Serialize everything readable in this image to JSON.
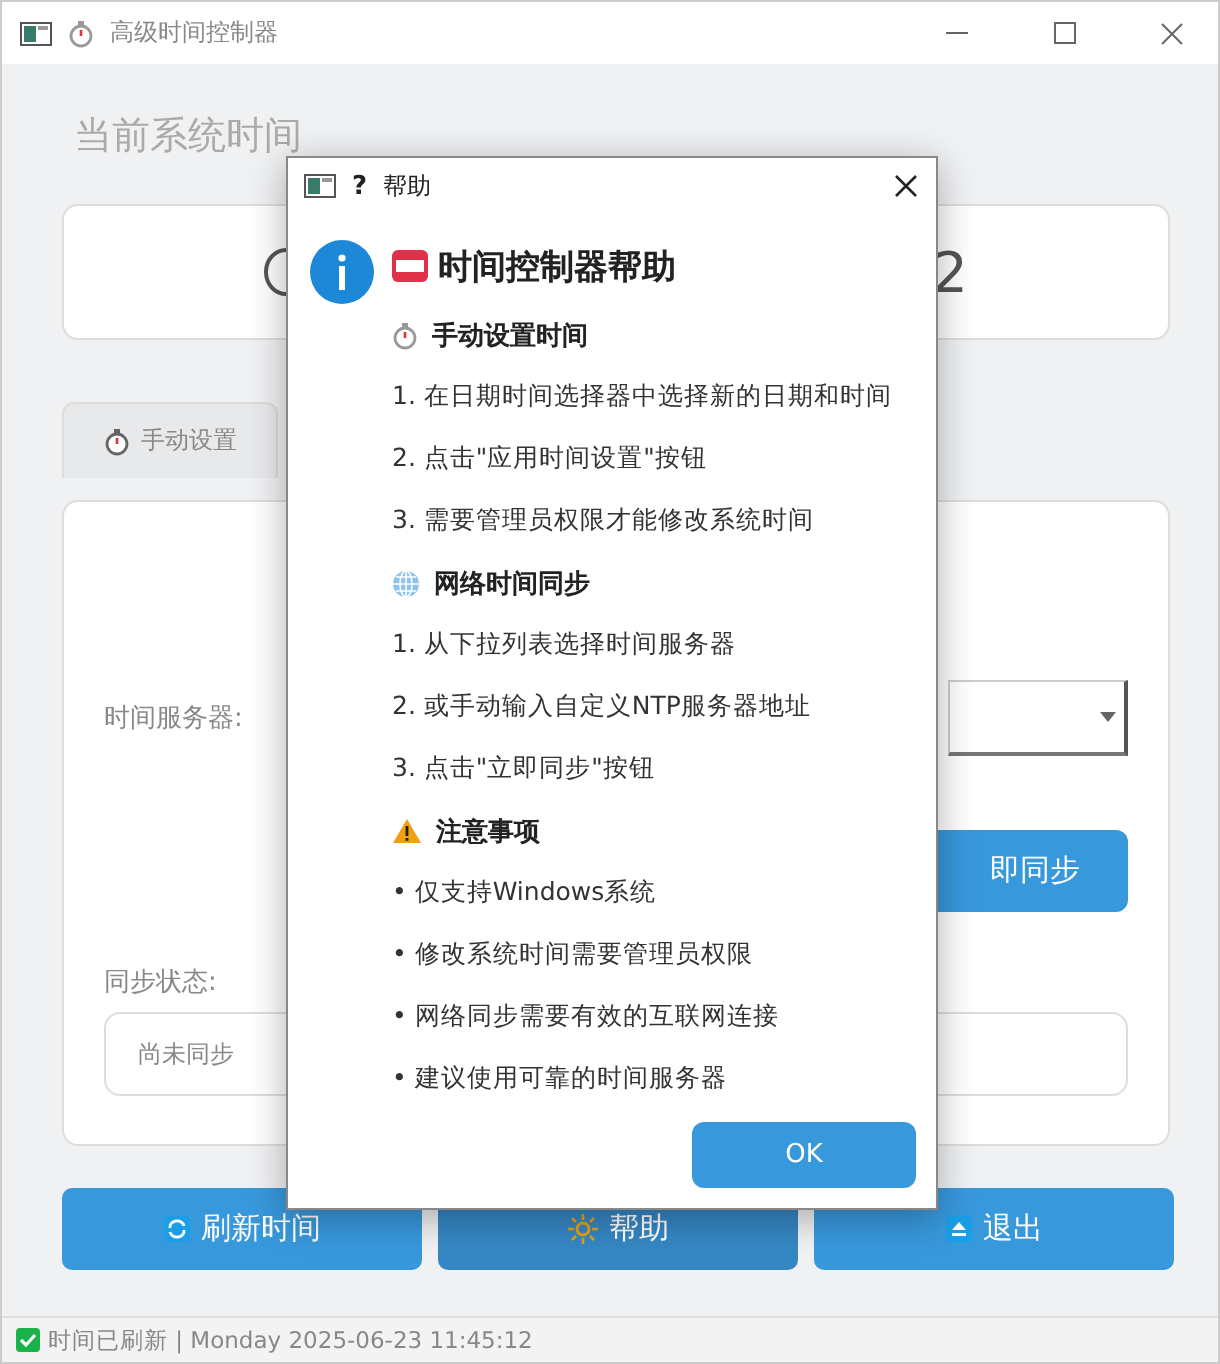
{
  "window": {
    "title": "高级时间控制器"
  },
  "main": {
    "heading": "当前系统时间",
    "time_fragment": "2",
    "tab": {
      "label": "手动设置",
      "selected": false
    },
    "server_label": "时间服务器:",
    "sync_button": "即同步",
    "status_label": "同步状态:",
    "status_value": "尚未同步"
  },
  "buttons": [
    {
      "kind": "refresh",
      "label": "刷新时间"
    },
    {
      "kind": "help",
      "label": "帮助"
    },
    {
      "kind": "exit",
      "label": "退出"
    }
  ],
  "status_bar": {
    "text": "时间已刷新 | Monday 2025-06-23 11:45:12"
  },
  "dialog": {
    "title_mark": "?",
    "title": "帮助",
    "heading": "时间控制器帮助",
    "sections": [
      {
        "kind": "timer",
        "title": "手动设置时间",
        "items": [
          "1. 在日期时间选择器中选择新的日期和时间",
          "2. 点击\"应用时间设置\"按钮",
          "3. 需要管理员权限才能修改系统时间"
        ]
      },
      {
        "kind": "globe",
        "title": "网络时间同步",
        "items": [
          "1. 从下拉列表选择时间服务器",
          "2. 或手动输入自定义NTP服务器地址",
          "3. 点击\"立即同步\"按钮"
        ]
      },
      {
        "kind": "warning",
        "title": "注意事项",
        "items": [
          "• 仅支持Windows系统",
          "• 修改系统时间需要管理员权限",
          "• 网络同步需要有效的互联网连接",
          "• 建议使用可靠的时间服务器"
        ]
      }
    ],
    "ok": "OK"
  }
}
